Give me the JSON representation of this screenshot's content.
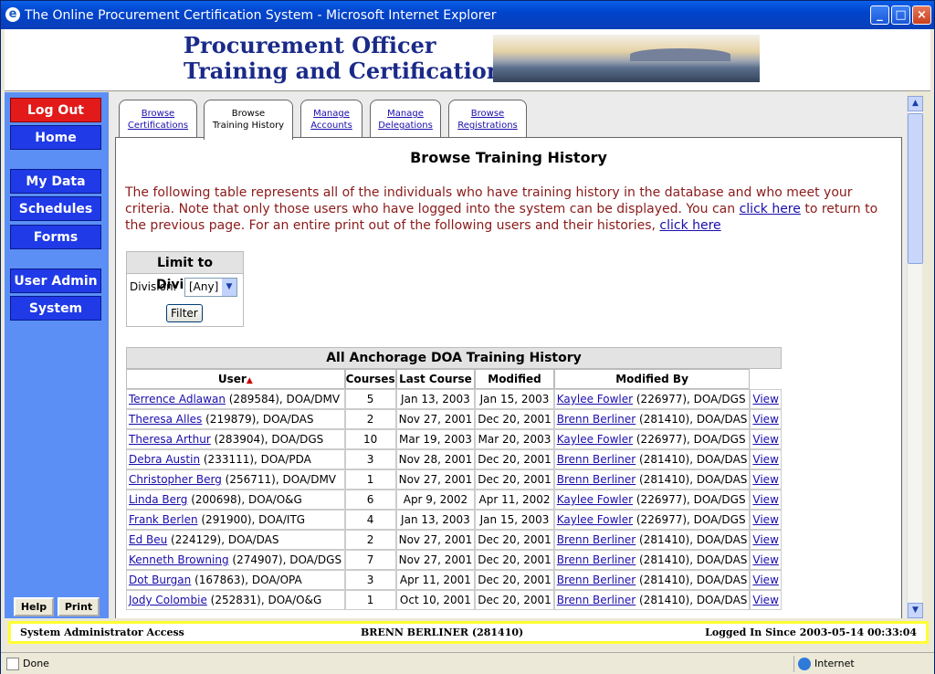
{
  "window": {
    "title": "The Online Procurement Certification System - Microsoft Internet Explorer"
  },
  "header": {
    "line1": "Procurement Officer",
    "line2": "Training and Certification"
  },
  "nav": {
    "logout": "Log Out",
    "home": "Home",
    "my_data": "My Data",
    "schedules": "Schedules",
    "forms": "Forms",
    "user_admin": "User Admin",
    "system": "System",
    "help": "Help",
    "print": "Print"
  },
  "tabs": [
    {
      "line1": "Browse",
      "line2": "Certifications"
    },
    {
      "line1": "Browse",
      "line2": "Training History"
    },
    {
      "line1": "Manage",
      "line2": "Accounts"
    },
    {
      "line1": "Manage",
      "line2": "Delegations"
    },
    {
      "line1": "Browse",
      "line2": "Registrations"
    }
  ],
  "page": {
    "title": "Browse Training History",
    "intro_1": "The following table represents all of the individuals who have training history in the database and who meet your criteria. Note that only those users who have logged into the system can be displayed. You can ",
    "link_1": "click here",
    "intro_2": " to return to the previous page. For an entire print out of the following users and their histories, ",
    "link_2": "click here"
  },
  "filter": {
    "title": "Limit to Division",
    "label": "Division:",
    "value": "[Any]",
    "button": "Filter"
  },
  "table": {
    "caption": "All Anchorage DOA Training History",
    "headers": {
      "user": "User",
      "courses": "Courses",
      "last_course": "Last Course",
      "modified": "Modified",
      "modified_by": "Modified By"
    },
    "rows": [
      {
        "name": "Terrence Adlawan",
        "info": " (289584), DOA/DMV",
        "courses": "5",
        "last": "Jan 13, 2003",
        "modified": "Jan 15, 2003",
        "by_name": "Kaylee Fowler",
        "by_info": " (226977), DOA/DGS",
        "view": "View"
      },
      {
        "name": "Theresa Alles",
        "info": " (219879), DOA/DAS",
        "courses": "2",
        "last": "Nov 27, 2001",
        "modified": "Dec 20, 2001",
        "by_name": "Brenn Berliner",
        "by_info": " (281410), DOA/DAS",
        "view": "View"
      },
      {
        "name": "Theresa Arthur",
        "info": " (283904), DOA/DGS",
        "courses": "10",
        "last": "Mar 19, 2003",
        "modified": "Mar 20, 2003",
        "by_name": "Kaylee Fowler",
        "by_info": " (226977), DOA/DGS",
        "view": "View"
      },
      {
        "name": "Debra Austin",
        "info": " (233111), DOA/PDA",
        "courses": "3",
        "last": "Nov 28, 2001",
        "modified": "Dec 20, 2001",
        "by_name": "Brenn Berliner",
        "by_info": " (281410), DOA/DAS",
        "view": "View"
      },
      {
        "name": "Christopher Berg",
        "info": " (256711), DOA/DMV",
        "courses": "1",
        "last": "Nov 27, 2001",
        "modified": "Dec 20, 2001",
        "by_name": "Brenn Berliner",
        "by_info": " (281410), DOA/DAS",
        "view": "View"
      },
      {
        "name": "Linda Berg",
        "info": " (200698), DOA/O&G",
        "courses": "6",
        "last": "Apr 9, 2002",
        "modified": "Apr 11, 2002",
        "by_name": "Kaylee Fowler",
        "by_info": " (226977), DOA/DGS",
        "view": "View"
      },
      {
        "name": "Frank Berlen",
        "info": " (291900), DOA/ITG",
        "courses": "4",
        "last": "Jan 13, 2003",
        "modified": "Jan 15, 2003",
        "by_name": "Kaylee Fowler",
        "by_info": " (226977), DOA/DGS",
        "view": "View"
      },
      {
        "name": "Ed Beu",
        "info": " (224129), DOA/DAS",
        "courses": "2",
        "last": "Nov 27, 2001",
        "modified": "Dec 20, 2001",
        "by_name": "Brenn Berliner",
        "by_info": " (281410), DOA/DAS",
        "view": "View"
      },
      {
        "name": "Kenneth Browning",
        "info": " (274907), DOA/DGS",
        "courses": "7",
        "last": "Nov 27, 2001",
        "modified": "Dec 20, 2001",
        "by_name": "Brenn Berliner",
        "by_info": " (281410), DOA/DAS",
        "view": "View"
      },
      {
        "name": "Dot Burgan",
        "info": " (167863), DOA/OPA",
        "courses": "3",
        "last": "Apr 11, 2001",
        "modified": "Dec 20, 2001",
        "by_name": "Brenn Berliner",
        "by_info": " (281410), DOA/DAS",
        "view": "View"
      },
      {
        "name": "Jody Colombie",
        "info": " (252831), DOA/O&G",
        "courses": "1",
        "last": "Oct 10, 2001",
        "modified": "Dec 20, 2001",
        "by_name": "Brenn Berliner",
        "by_info": " (281410), DOA/DAS",
        "view": "View"
      }
    ]
  },
  "status": {
    "access": "System Administrator Access",
    "user": "BRENN BERLINER (281410)",
    "logged_in": "Logged In Since 2003-05-14 00:33:04"
  },
  "browser_status": {
    "text": "Done",
    "zone": "Internet"
  }
}
